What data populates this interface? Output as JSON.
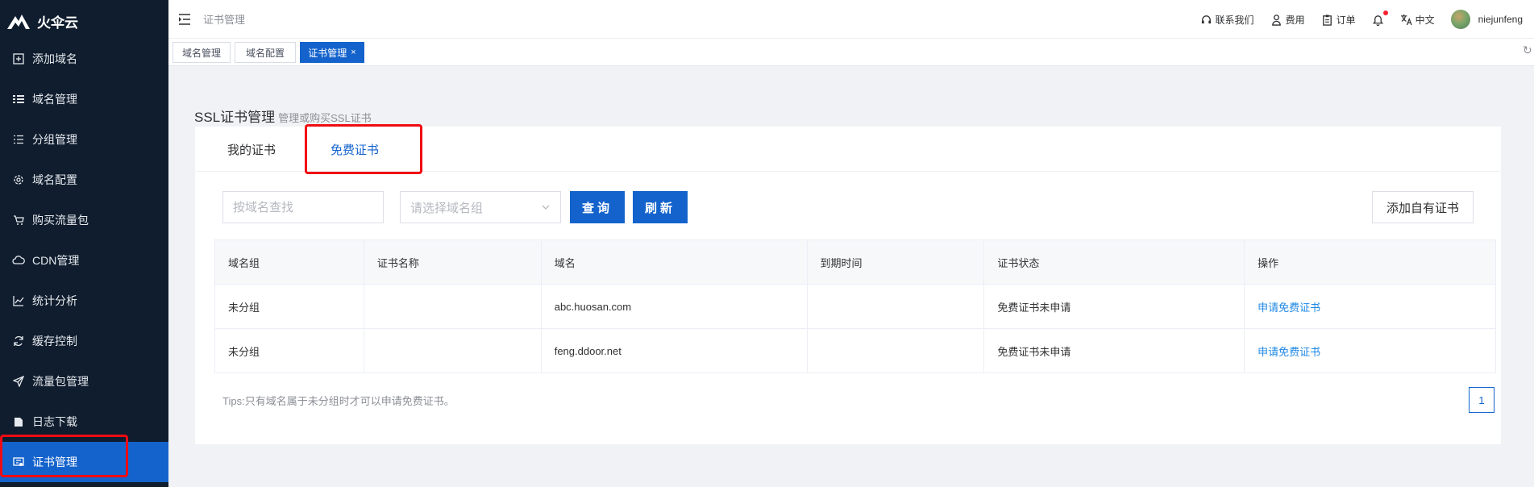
{
  "app": {
    "logo_text": "火伞云"
  },
  "sidebar": {
    "items": [
      {
        "label": "添加域名",
        "icon": "plus-square-icon"
      },
      {
        "label": "域名管理",
        "icon": "list-icon"
      },
      {
        "label": "分组管理",
        "icon": "group-list-icon"
      },
      {
        "label": "域名配置",
        "icon": "gear-icon"
      },
      {
        "label": "购买流量包",
        "icon": "cart-icon"
      },
      {
        "label": "CDN管理",
        "icon": "cloud-icon"
      },
      {
        "label": "统计分析",
        "icon": "chart-line-icon"
      },
      {
        "label": "缓存控制",
        "icon": "refresh-icon"
      },
      {
        "label": "流量包管理",
        "icon": "send-icon"
      },
      {
        "label": "日志下载",
        "icon": "file-icon"
      },
      {
        "label": "证书管理",
        "icon": "certificate-icon",
        "active": true
      }
    ]
  },
  "topbar": {
    "breadcrumb": "证书管理",
    "contact": "联系我们",
    "billing": "费用",
    "orders": "订单",
    "language": "中文",
    "username": "niejunfeng"
  },
  "page_tabs": [
    {
      "label": "域名管理"
    },
    {
      "label": "域名配置"
    },
    {
      "label": "证书管理",
      "close": "×",
      "active": true
    }
  ],
  "section": {
    "title": "SSL证书管理",
    "subtitle": "管理或购买SSL证书"
  },
  "panel_tabs": [
    {
      "label": "我的证书"
    },
    {
      "label": "免费证书",
      "active": true
    }
  ],
  "filters": {
    "domain_placeholder": "按域名查找",
    "group_placeholder": "请选择域名组",
    "query_button": "查询",
    "refresh_button": "刷新",
    "add_cert_button": "添加自有证书"
  },
  "table": {
    "headers": [
      "域名组",
      "证书名称",
      "域名",
      "到期时间",
      "证书状态",
      "操作"
    ],
    "rows": [
      {
        "group": "未分组",
        "cert_name": "",
        "domain": "abc.huosan.com",
        "expire": "",
        "status": "免费证书未申请",
        "action": "申请免费证书"
      },
      {
        "group": "未分组",
        "cert_name": "",
        "domain": "feng.ddoor.net",
        "expire": "",
        "status": "免费证书未申请",
        "action": "申请免费证书"
      }
    ]
  },
  "tips": "Tips:只有域名属于未分组时才可以申请免费证书。",
  "pagination": {
    "current": "1"
  },
  "colors": {
    "primary": "#1463cc",
    "sidebar_bg": "#0f1d2e",
    "status_red": "#f5222d",
    "link_blue": "#1e88e5",
    "highlight": "#f00b13"
  }
}
